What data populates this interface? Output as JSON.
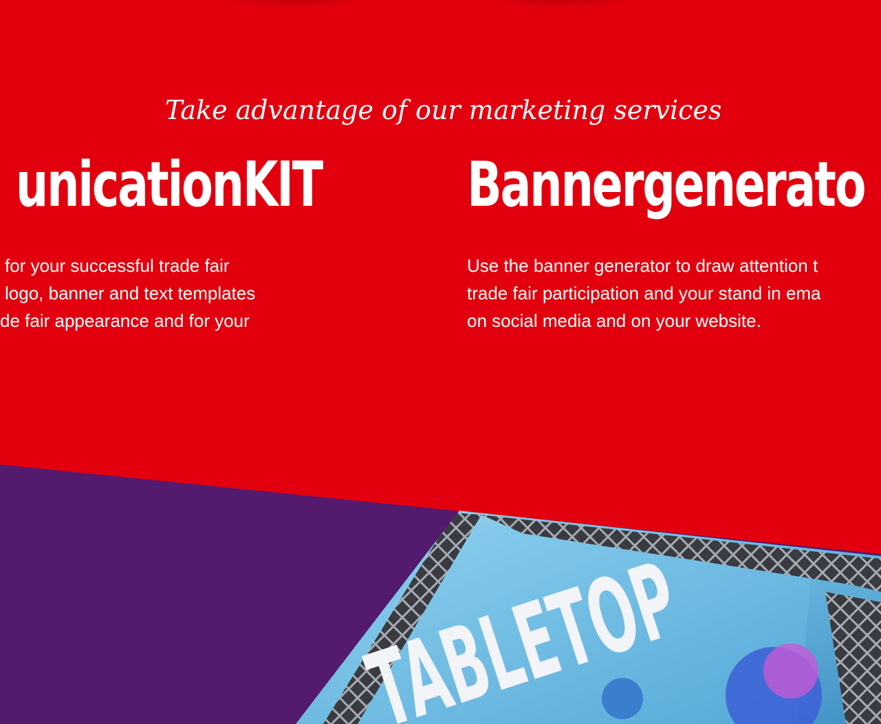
{
  "section": {
    "tagline": "Take advantage of our marketing services"
  },
  "cards": [
    {
      "title": "unicationKIT",
      "lines": [
        "for your successful trade fair",
        "logo, banner and text templates",
        "de fair appearance and for your"
      ]
    },
    {
      "title": "Bannergenerato",
      "lines": [
        "Use the banner generator to draw attention t",
        "trade fair participation and your stand in ema",
        "on social media and on your website."
      ]
    }
  ],
  "image": {
    "banner_text": "TABLETOP"
  },
  "colors": {
    "red": "#e2000f",
    "purple": "#531a6e",
    "white": "#ffffff",
    "sky": "#7fc4e6"
  }
}
